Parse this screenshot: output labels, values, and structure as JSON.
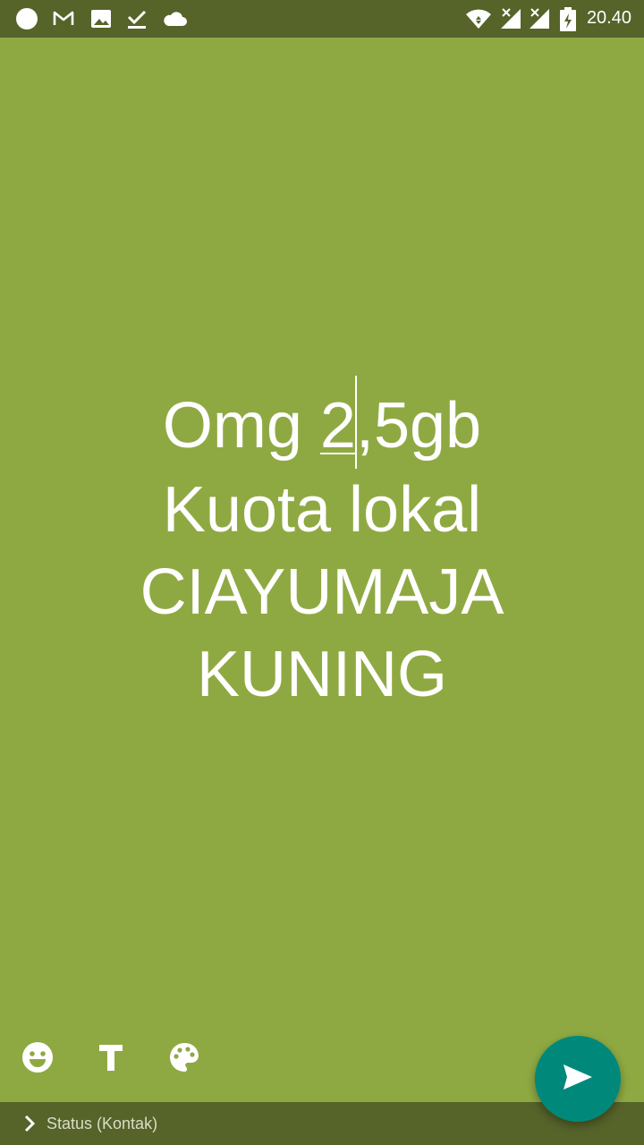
{
  "status_bar": {
    "time": "20.40",
    "background": "#566329",
    "left_icons": [
      "circle-icon",
      "gmail-icon",
      "gallery-icon",
      "download-done-icon",
      "cloud-icon"
    ],
    "right_icons": [
      "wifi-icon",
      "signal-no-data-icon",
      "signal-no-data-icon",
      "battery-charging-icon"
    ]
  },
  "editor": {
    "background": "#8fa942",
    "lines": [
      "Omg 2,5gb",
      "Kuota lokal",
      "CIAYUMAJA",
      "KUNING"
    ],
    "line1_part_a": "Omg ",
    "line1_part_b": "2",
    "line1_part_c": ",5gb"
  },
  "toolbar": {
    "icons": [
      "emoji-icon",
      "text-format-icon",
      "palette-icon"
    ]
  },
  "bottom_bar": {
    "label": "Status (Kontak)",
    "background": "#566329"
  },
  "fab": {
    "icon": "send-icon",
    "color": "#00897b"
  }
}
